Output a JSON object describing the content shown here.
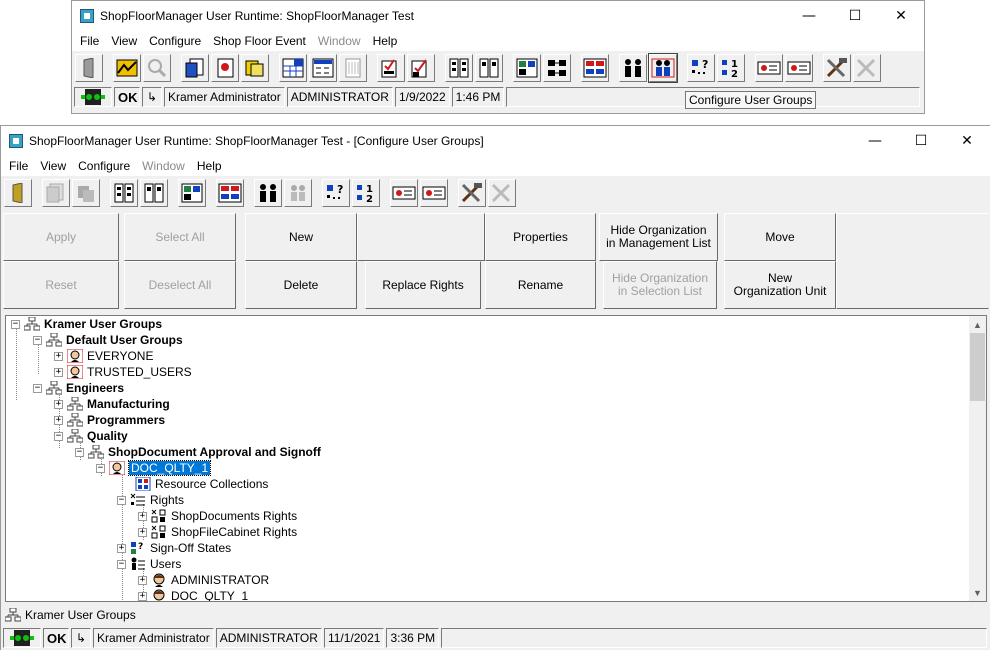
{
  "window1": {
    "title": "ShopFloorManager User Runtime: ShopFloorManager Test",
    "menu": [
      "File",
      "View",
      "Configure",
      "Shop Floor Event",
      "Window",
      "Help"
    ],
    "status": {
      "ok": "OK",
      "arrow": "↳",
      "user_name": "Kramer Administrator",
      "user_id": "ADMINISTRATOR",
      "date": "1/9/2022",
      "time": "1:46 PM"
    },
    "tooltip": "Configure User Groups"
  },
  "window2": {
    "title": "ShopFloorManager User Runtime: ShopFloorManager Test - [Configure User Groups]",
    "menu": [
      "File",
      "View",
      "Configure",
      "Window",
      "Help"
    ],
    "buttons": {
      "apply": "Apply",
      "reset": "Reset",
      "select_all": "Select All",
      "deselect_all": "Deselect All",
      "new": "New",
      "delete": "Delete",
      "replace_rights": "Replace Rights",
      "properties": "Properties",
      "rename": "Rename",
      "hide_mgmt": "Hide Organization in Management List",
      "hide_sel": "Hide Organization in Selection List",
      "move": "Move",
      "new_org": "New Organization Unit"
    },
    "tree": [
      {
        "label": "Kramer User Groups",
        "bold": true
      },
      {
        "label": "Default User Groups",
        "bold": true
      },
      {
        "label": "EVERYONE"
      },
      {
        "label": "TRUSTED_USERS"
      },
      {
        "label": "Engineers",
        "bold": true
      },
      {
        "label": "Manufacturing",
        "bold": true
      },
      {
        "label": "Programmers",
        "bold": true
      },
      {
        "label": "Quality",
        "bold": true
      },
      {
        "label": "ShopDocument Approval and Signoff",
        "bold": true
      },
      {
        "label": "DOC_QLTY_1",
        "selected": true
      },
      {
        "label": "Resource Collections"
      },
      {
        "label": "Rights"
      },
      {
        "label": "ShopDocuments Rights"
      },
      {
        "label": "ShopFileCabinet Rights"
      },
      {
        "label": "Sign-Off States"
      },
      {
        "label": "Users"
      },
      {
        "label": "ADMINISTRATOR"
      },
      {
        "label": "DOC_QLTY_1"
      }
    ],
    "info": "Kramer User Groups",
    "status": {
      "ok": "OK",
      "arrow": "↳",
      "user_name": "Kramer Administrator",
      "user_id": "ADMINISTRATOR",
      "date": "11/1/2021",
      "time": "3:36 PM"
    }
  },
  "colors": {
    "selection": "#0078d7",
    "accent_red": "#d01818"
  }
}
